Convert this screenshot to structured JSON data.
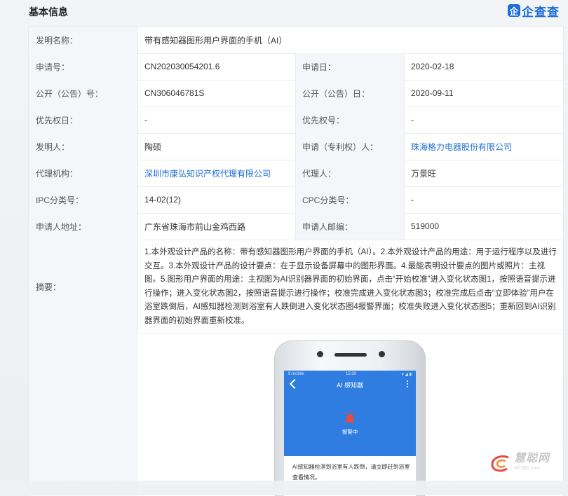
{
  "header": {
    "title": "基本信息",
    "logo_mark": "企",
    "logo_text": "企查查"
  },
  "rows": [
    {
      "label": "发明名称：",
      "value": "带有感知器图形用户界面的手机（AI）"
    },
    {
      "label": "申请号：",
      "value": "CN202030054201.6",
      "label2": "申请日：",
      "value2": "2020-02-18"
    },
    {
      "label": "公开（公告）号：",
      "value": "CN306046781S",
      "label2": "公开（公告）日：",
      "value2": "2020-09-11"
    },
    {
      "label": "优先权日：",
      "value": "-",
      "label2": "优先权号：",
      "value2": "-"
    },
    {
      "label": "发明人：",
      "value": "陶硕",
      "label2": "申请（专利权）人：",
      "value2": "珠海格力电器股份有限公司"
    },
    {
      "label": "代理机构：",
      "value": "深圳市康弘知识产权代理有限公司",
      "label2": "代理人：",
      "value2": "万景旺"
    },
    {
      "label": "IPC分类号：",
      "value": "14-02(12)",
      "label2": "CPC分类号：",
      "value2": "-"
    },
    {
      "label": "申请人地址：",
      "value": "广东省珠海市前山金鸡西路",
      "label2": "申请人邮编：",
      "value2": "519000"
    }
  ],
  "abstract": {
    "label": "摘要：",
    "text": "1.本外观设计产品的名称：带有感知器图形用户界面的手机（AI）。2.本外观设计产品的用途：用于运行程序以及进行交互。3.本外观设计产品的设计要点：在于显示设备屏幕中的图形界面。4.最能表明设计要点的图片或照片：主视图。5.图形用户界面的用途：主视图为AI识别器界面的初始界面，点击“开始校准”进入变化状态图1，按照语音提示进行操作；进入变化状态图2，按照语音提示进行操作；校准完成进入变化状态图3；校准完成后点击“立即体验”用户在浴室跌倒后，AI感知器检测到浴室有人跌倒进入变化状态图4报警界面；校准失败进入变化状态图5；重新回到AI识别器界面的初始界面重新校准。"
  },
  "phone": {
    "status_left": "9:mobile",
    "status_center": "15:30",
    "status_right": "▾ ◢ ▮",
    "app_title": "AI 感知器",
    "alarm_label": "报警中",
    "notice": "AI感知器检测到浴室有人跌倒，请立即赶到浴室查看情况。"
  },
  "watermark": {
    "main": "慧聪网",
    "sub": "HC360.com"
  },
  "colors": {
    "link": "#1f6fcf",
    "brand": "#1a6fd6",
    "app_blue": "#2f7de0",
    "alarm_red": "#e84a3c"
  }
}
